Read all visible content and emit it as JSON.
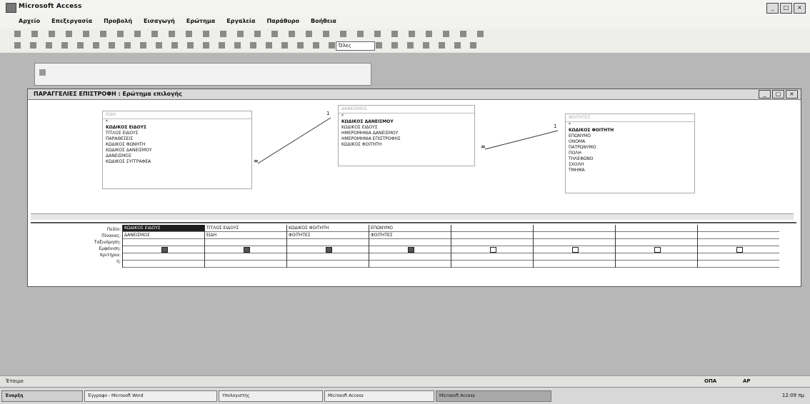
{
  "app": {
    "title": "Microsoft Access"
  },
  "menu": [
    "Αρχείο",
    "Επεξεργασία",
    "Προβολή",
    "Εισαγωγή",
    "Ερώτημα",
    "Εργαλεία",
    "Παράθυρο",
    "Βοήθεια"
  ],
  "toolbar": {
    "view_combo": "Όλες"
  },
  "db_window": {
    "title": ""
  },
  "query_window": {
    "title": "ΠΑΡΑΓΓΕΛΙΕΣ ΕΠΙΣΤΡΟΦΗ : Ερώτημα επιλογής"
  },
  "tables": [
    {
      "name": "ΕΙΔΗ",
      "fields": [
        "*",
        "ΚΩΔΙΚΟΣ ΕΙΔΟΥΣ",
        "ΤΙΤΛΟΣ ΕΙΔΟΥΣ",
        "ΠΑΡΑΘΕΣΕΙΣ",
        "ΚΩΔΙΚΟΣ ΦΩΝΗΤΗ",
        "ΚΩΔΙΚΟΣ ΔΑΝΕΙΣΜΟΥ",
        "ΔΑΝΕΙΣΜΟΣ",
        "ΚΩΔΙΚΟΣ ΣΥΓΓΡΑΦΕΑ"
      ]
    },
    {
      "name": "ΔΑΝΕΙΣΜΟΣ",
      "fields": [
        "*",
        "ΚΩΔΙΚΟΣ ΔΑΝΕΙΣΜΟΥ",
        "ΚΩΔΙΚΟΣ ΕΙΔΟΥΣ",
        "ΗΜΕΡΟΜΗΝΙΑ ΔΑΝΕΙΣΜΟΥ",
        "ΗΜΕΡΟΜΗΝΙΑ ΕΠΙΣΤΡΟΦΗΣ",
        "ΚΩΔΙΚΟΣ ΦΟΙΤΗΤΗ"
      ]
    },
    {
      "name": "ΦΟΙΤΗΤΕΣ",
      "fields": [
        "*",
        "ΚΩΔΙΚΟΣ ΦΟΙΤΗΤΗ",
        "ΕΠΩΝΥΜΟ",
        "ΟΝΟΜΑ",
        "ΠΑΤΡΩΝΥΜΟ",
        "ΠΟΛΗ",
        "ΤΗΛΕΦΩΝΟ",
        "ΣΧΟΛΗ",
        "ΤΜΗΜΑ"
      ]
    }
  ],
  "relation_labels": [
    "∞",
    "1",
    "∞",
    "1"
  ],
  "grid": {
    "row_labels": [
      "Πεδίο:",
      "Πίνακας:",
      "Ταξινόμηση:",
      "Εμφάνιση:",
      "Κριτήρια:",
      "ή:"
    ],
    "columns": [
      {
        "field": "ΚΩΔΙΚΟΣ ΕΙΔΟΥΣ",
        "table": "ΔΑΝΕΙΣΜΟΣ",
        "show": true
      },
      {
        "field": "ΤΙΤΛΟΣ ΕΙΔΟΥΣ",
        "table": "ΕΙΔΗ",
        "show": true
      },
      {
        "field": "ΚΩΔΙΚΟΣ ΦΟΙΤΗΤΗ",
        "table": "ΦΟΙΤΗΤΕΣ",
        "show": true
      },
      {
        "field": "ΕΠΩΝΥΜΟ",
        "table": "ΦΟΙΤΗΤΕΣ",
        "show": true
      },
      {
        "field": "",
        "table": "",
        "show": false
      },
      {
        "field": "",
        "table": "",
        "show": false
      },
      {
        "field": "",
        "table": "",
        "show": false
      },
      {
        "field": "",
        "table": "",
        "show": false
      }
    ]
  },
  "status": {
    "left": "Έτοιμο",
    "right1": "ΟΠΑ",
    "right2": "ΑΡ"
  },
  "taskbar": {
    "start": "Έναρξη",
    "tasks": [
      "Έγγραφο - Microsoft Word",
      "Υπολογιστής",
      "Microsoft Access",
      "Microsoft Access"
    ],
    "clock": "12:09 πμ"
  }
}
